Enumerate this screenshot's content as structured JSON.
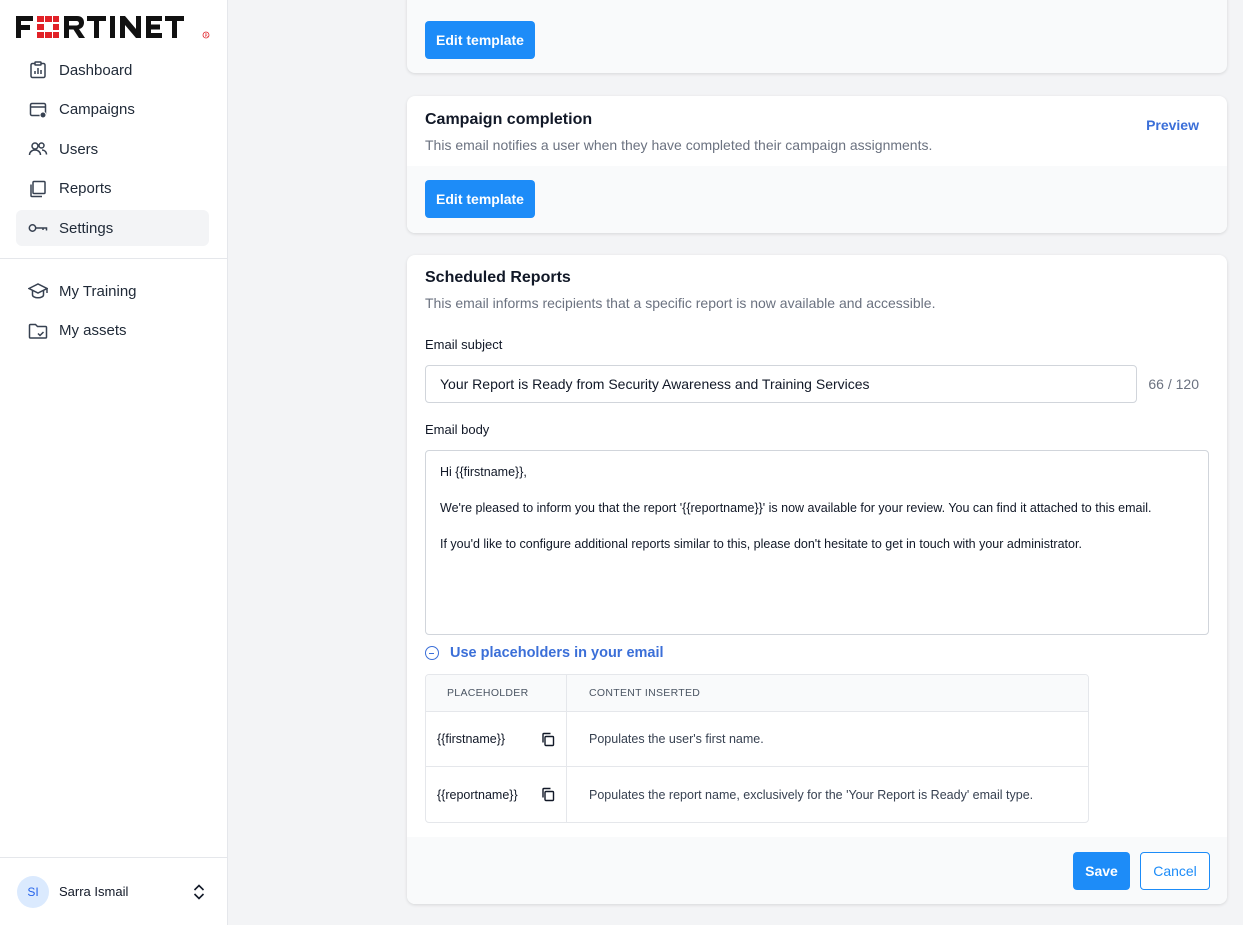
{
  "brand": {
    "logo_text": "FORTINET",
    "accent": "#e12127"
  },
  "sidebar": {
    "primary_items": [
      {
        "label": "Dashboard",
        "icon": "dashboard-icon"
      },
      {
        "label": "Campaigns",
        "icon": "campaigns-icon"
      },
      {
        "label": "Users",
        "icon": "users-icon"
      },
      {
        "label": "Reports",
        "icon": "reports-icon"
      },
      {
        "label": "Settings",
        "icon": "settings-key-icon",
        "active": true
      }
    ],
    "secondary_items": [
      {
        "label": "My Training",
        "icon": "graduation-cap-icon"
      },
      {
        "label": "My assets",
        "icon": "folder-icon"
      }
    ],
    "user": {
      "initials": "SI",
      "name": "Sarra Ismail"
    }
  },
  "cards": {
    "top": {
      "edit_label": "Edit template"
    },
    "completion": {
      "title": "Campaign completion",
      "description": "This email notifies a user when they have completed their campaign assignments.",
      "preview_label": "Preview",
      "edit_label": "Edit template"
    },
    "scheduled": {
      "title": "Scheduled Reports",
      "description": "This email informs recipients that a specific report is now available and accessible.",
      "subject_label": "Email subject",
      "subject_value": "Your Report is Ready from Security Awareness and Training Services",
      "char_count": "66 / 120",
      "body_label": "Email body",
      "body_lines": [
        "Hi {{firstname}},",
        "We're pleased to inform you that the report '{{reportname}}' is now available for your review. You can find it attached to this email.",
        "If you'd like to configure additional reports similar to this, please don't hesitate to get in touch with your administrator."
      ],
      "placeholders_toggle": "Use placeholders in your email",
      "table": {
        "headers": [
          "PLACEHOLDER",
          "CONTENT INSERTED"
        ],
        "rows": [
          {
            "placeholder": "{{firstname}}",
            "content": "Populates the user's first name."
          },
          {
            "placeholder": "{{reportname}}",
            "content": "Populates the report name, exclusively for the 'Your Report is Ready' email type."
          }
        ]
      },
      "save_label": "Save",
      "cancel_label": "Cancel"
    }
  },
  "colors": {
    "primary": "#1d8cf8",
    "link": "#3b6fd8"
  }
}
